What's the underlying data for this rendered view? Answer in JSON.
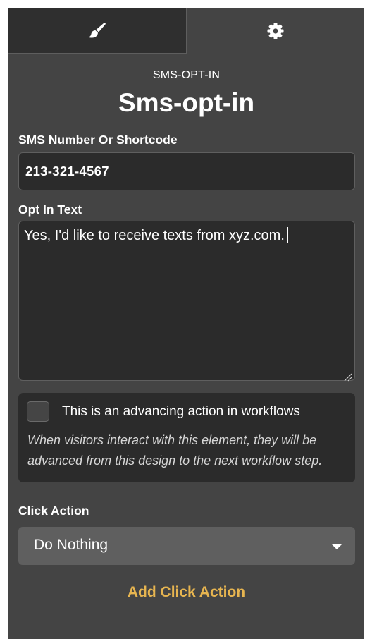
{
  "tabs": [
    {
      "icon": "paintbrush-icon",
      "active": true
    },
    {
      "icon": "gear-icon",
      "active": false
    }
  ],
  "element": {
    "type_label": "SMS-OPT-IN",
    "name": "Sms-opt-in"
  },
  "sms_field": {
    "label": "SMS Number Or Shortcode",
    "value": "213-321-4567"
  },
  "optin_field": {
    "label": "Opt In Text",
    "value": "Yes, I'd like to receive texts from xyz.com."
  },
  "advancing": {
    "label": "This is an advancing action in workflows",
    "help": "When visitors interact with this element, they will be advanced from this design to the next workflow step.",
    "checked": false
  },
  "click_action": {
    "label": "Click Action",
    "selected": "Do Nothing",
    "add_label": "Add Click Action"
  },
  "colors": {
    "panel_bg": "#444444",
    "input_bg": "#2b2b2b",
    "accent": "#e7b550"
  }
}
